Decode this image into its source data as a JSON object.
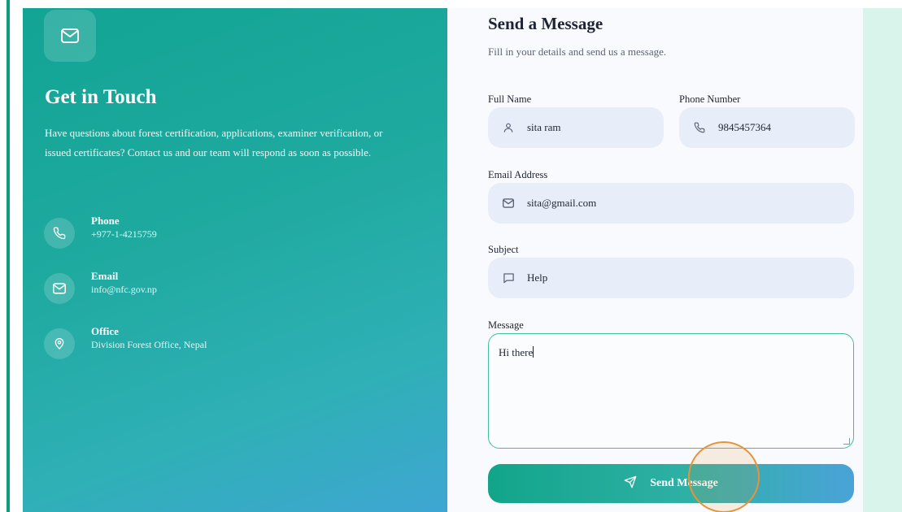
{
  "info": {
    "icon": "mail-icon",
    "title": "Get in Touch",
    "description": "Have questions about forest certification, applications, examiner verification, or issued certificates? Contact us and our team will respond as soon as possible.",
    "contacts": [
      {
        "icon": "phone-icon",
        "label": "Phone",
        "value": "+977-1-4215759"
      },
      {
        "icon": "mail-icon",
        "label": "Email",
        "value": "info@nfc.gov.np"
      },
      {
        "icon": "map-pin-icon",
        "label": "Office",
        "value": "Division Forest Office, Nepal"
      }
    ]
  },
  "form": {
    "title": "Send a Message",
    "subtitle": "Fill in your details and send us a message.",
    "full_name": {
      "label": "Full Name",
      "value": "sita ram",
      "icon": "user-icon"
    },
    "phone": {
      "label": "Phone Number",
      "value": "9845457364",
      "icon": "phone-icon"
    },
    "email": {
      "label": "Email Address",
      "value": "sita@gmail.com",
      "icon": "mail-icon"
    },
    "subject": {
      "label": "Subject",
      "value": "Help",
      "icon": "chat-icon"
    },
    "message": {
      "label": "Message",
      "value": "Hi there"
    },
    "submit": {
      "label": "Send Message",
      "icon": "send-icon"
    }
  },
  "colors": {
    "accent": "#12a58a",
    "panel_gradient_start": "#12a494",
    "panel_gradient_end": "#3fa6d3",
    "field_bg": "#e7edf9",
    "click_indicator": "#e7933a"
  }
}
